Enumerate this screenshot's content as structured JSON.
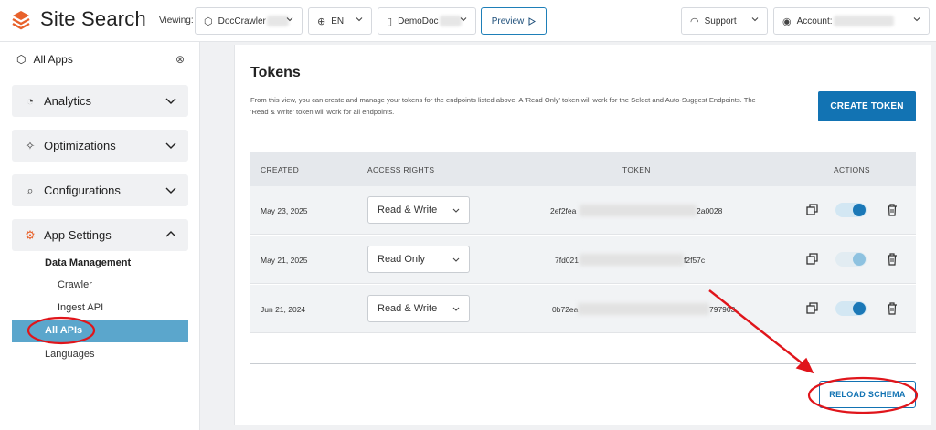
{
  "header": {
    "brand": "Site Search",
    "viewing_label": "Viewing:",
    "app_selector": "DocCrawler",
    "language_selector": "EN",
    "doc_selector": "DemoDoc",
    "preview_label": "Preview",
    "support_label": "Support",
    "account_label": "Account:"
  },
  "sidebar": {
    "all_apps": "All Apps",
    "sections": [
      {
        "label": "Analytics",
        "icon": "pie-chart-icon",
        "expanded": false
      },
      {
        "label": "Optimizations",
        "icon": "sparkle-icon",
        "expanded": false
      },
      {
        "label": "Configurations",
        "icon": "search-icon",
        "expanded": false
      },
      {
        "label": "App Settings",
        "icon": "gear-icon",
        "expanded": true
      }
    ],
    "subsection": "Data Management",
    "sub_items": [
      "Crawler",
      "Ingest API"
    ],
    "active_item": "All APIs",
    "languages": "Languages"
  },
  "main": {
    "title": "Tokens",
    "description": "From this view, you can create and manage your tokens for the endpoints listed above. A 'Read Only' token will work for the Select and Auto-Suggest Endpoints. The 'Read & Write' token will work for all endpoints.",
    "create_button": "CREATE TOKEN",
    "columns": [
      "CREATED",
      "ACCESS RIGHTS",
      "TOKEN",
      "ACTIONS"
    ],
    "rows": [
      {
        "created": "May 23, 2025",
        "access": "Read & Write",
        "token_start": "2ef2fea",
        "token_end": "2a0028",
        "enabled": true
      },
      {
        "created": "May 21, 2025",
        "access": "Read Only",
        "token_start": "7fd021",
        "token_end": "f2f57c",
        "enabled": false
      },
      {
        "created": "Jun 21, 2024",
        "access": "Read & Write",
        "token_start": "0b72ea",
        "token_end": "797903",
        "enabled": true
      }
    ],
    "reload_button": "RELOAD SCHEMA"
  },
  "colors": {
    "brand_orange": "#e8622c",
    "primary_blue": "#1273b3",
    "active_nav": "#5ba6cc",
    "annotation_red": "#e0151b"
  }
}
